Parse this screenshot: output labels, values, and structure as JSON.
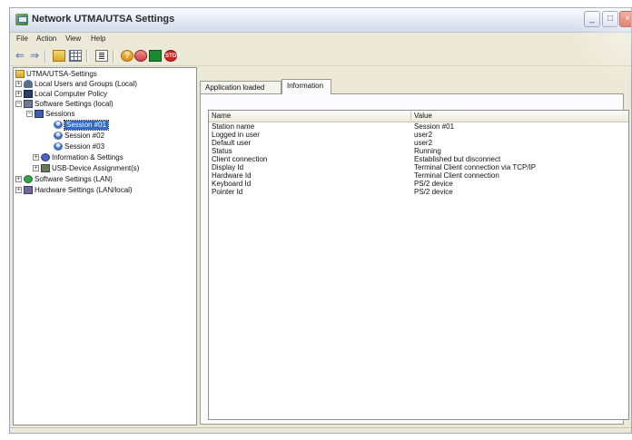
{
  "window": {
    "title": "Network UTMA/UTSA Settings",
    "controls": {
      "minimize": "_",
      "maximize": "□",
      "close": "×"
    }
  },
  "menu": [
    {
      "label": "File"
    },
    {
      "label": "Action"
    },
    {
      "label": "View"
    },
    {
      "label": "Help"
    }
  ],
  "toolbar": {
    "icons": [
      "back-arrow-icon",
      "forward-arrow-icon",
      "folder-up-icon",
      "grid-view-icon",
      "properties-icon",
      "help-icon",
      "network-icon",
      "green-icon",
      "stop-icon"
    ],
    "back": "⇐",
    "forward": "⇒",
    "help_glyph": "?",
    "stop_glyph": "STOP"
  },
  "tree": {
    "items": [
      {
        "label": "UTMA/UTSA-Settings",
        "icon": "root-folder-icon"
      },
      {
        "label": "Local Users and Groups (Local)",
        "icon": "users-icon",
        "expander": "+"
      },
      {
        "label": "Local Computer Policy",
        "icon": "policy-icon",
        "expander": "+"
      },
      {
        "label": "Software Settings (local)",
        "icon": "software-icon",
        "expander": "−"
      },
      {
        "label": "Sessions",
        "icon": "sessions-icon",
        "expander": "−"
      },
      {
        "label": "Session #01",
        "icon": "session-icon",
        "selected": true
      },
      {
        "label": "Session #02",
        "icon": "session-icon"
      },
      {
        "label": "Session #03",
        "icon": "session-icon"
      },
      {
        "label": "Information & Settings",
        "icon": "info-icon",
        "expander": "+"
      },
      {
        "label": "USB-Device Assignment(s)",
        "icon": "usb-icon",
        "expander": "+"
      },
      {
        "label": "Software Settings (LAN)",
        "icon": "software-lan-icon",
        "expander": "+"
      },
      {
        "label": "Hardware Settings (LAN/local)",
        "icon": "hardware-icon",
        "expander": "+"
      }
    ]
  },
  "tabs": [
    {
      "label": "Application loaded",
      "active": false
    },
    {
      "label": "Information",
      "active": true
    }
  ],
  "table": {
    "columns": [
      "Name",
      "Value"
    ],
    "rows": [
      [
        "Station name",
        "Session #01"
      ],
      [
        "Logged in user",
        "user2"
      ],
      [
        "Default user",
        "user2"
      ],
      [
        "Status",
        "Running"
      ],
      [
        "Client connection",
        "Established but disconnect"
      ],
      [
        "Display Id",
        "Terminal Client connection via TCP/IP"
      ],
      [
        "Hardware Id",
        "Terminal Client connection"
      ],
      [
        "Keyboard Id",
        "PS/2 device"
      ],
      [
        "Pointer Id",
        "PS/2 device"
      ]
    ]
  },
  "colors": {
    "selection": "#316ac5",
    "window_bg": "#ece9d8"
  }
}
